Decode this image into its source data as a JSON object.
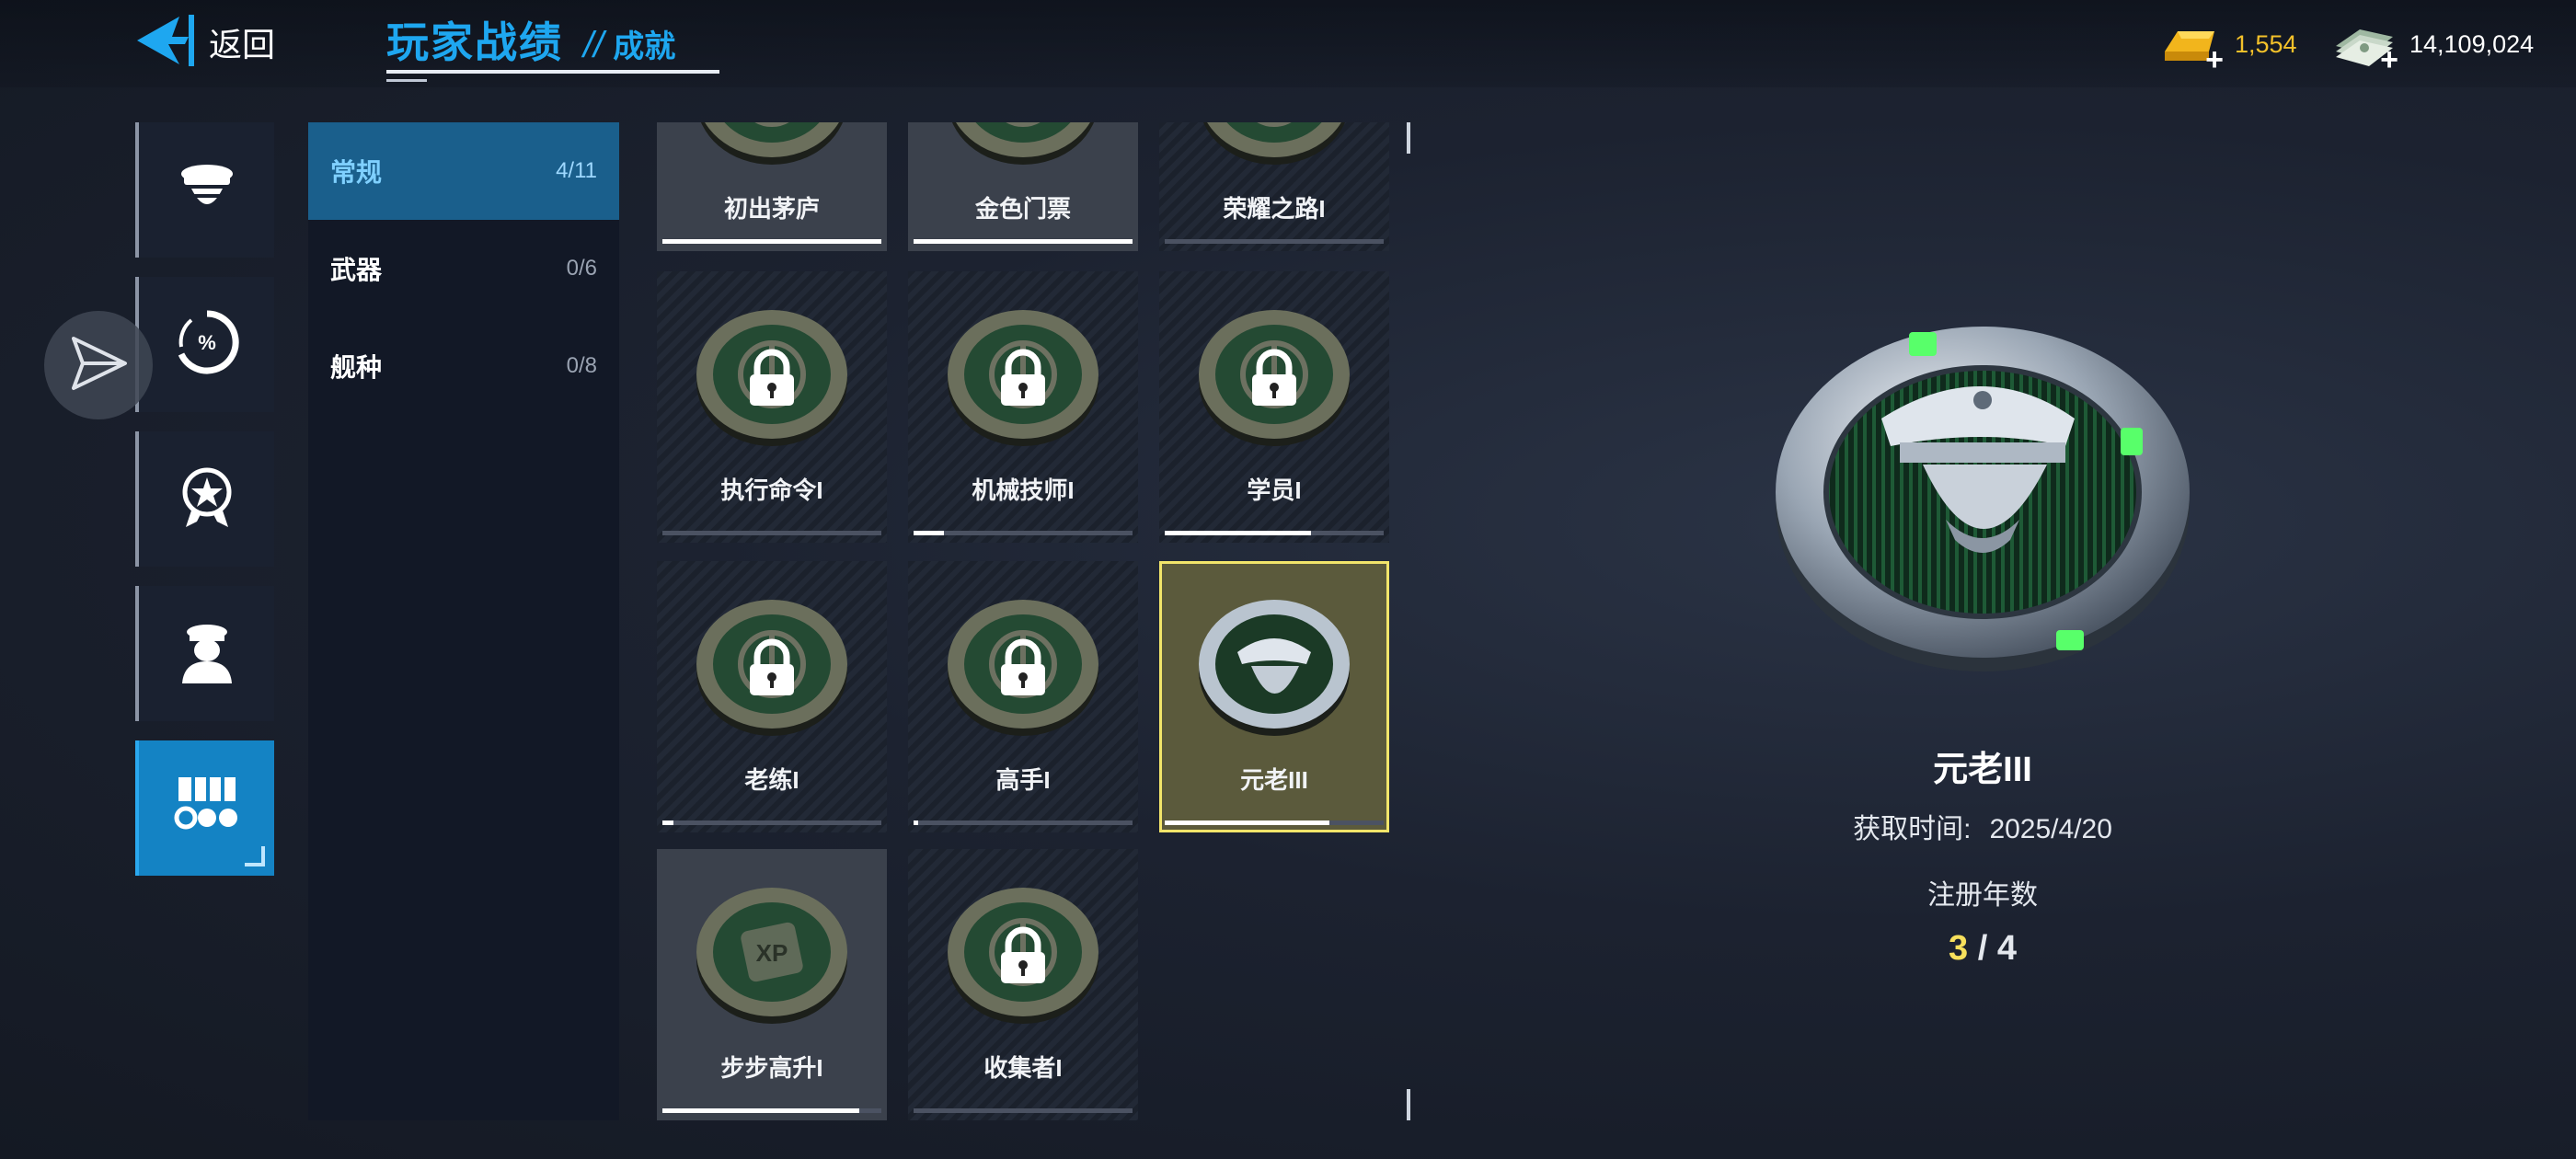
{
  "header": {
    "back_label": "返回",
    "title": "玩家战绩",
    "separator": "//",
    "subtitle": "成就"
  },
  "currency": {
    "gold": {
      "icon": "gold-bar-icon",
      "value": "1,554",
      "color": "#f4c12a"
    },
    "cash": {
      "icon": "cash-stack-icon",
      "value": "14,109,024",
      "color": "#ffffff"
    }
  },
  "nav": {
    "items": [
      {
        "icon": "officer-cap-icon",
        "active": false
      },
      {
        "icon": "percentage-gauge-icon",
        "active": false
      },
      {
        "icon": "star-badge-icon",
        "active": false
      },
      {
        "icon": "captain-bust-icon",
        "active": false
      },
      {
        "icon": "medals-ribbon-icon",
        "active": true
      }
    ],
    "floating_button_icon": "paper-plane-icon"
  },
  "categories": [
    {
      "label": "常规",
      "count": "4/11",
      "active": true
    },
    {
      "label": "武器",
      "count": "0/6",
      "active": false
    },
    {
      "label": "舰种",
      "count": "0/8",
      "active": false
    }
  ],
  "achievements": [
    {
      "label": "初出茅庐",
      "locked": false,
      "progress": 1.0,
      "icon": "anchor-medal-icon"
    },
    {
      "label": "金色门票",
      "locked": false,
      "progress": 1.0,
      "icon": "ticket-medal-icon"
    },
    {
      "label": "荣耀之路I",
      "locked": false,
      "progress": 0.0,
      "icon": "laurel-medal-icon"
    },
    {
      "label": "执行命令I",
      "locked": true,
      "progress": 0.0,
      "icon": "helm-wheel-medal-icon"
    },
    {
      "label": "机械技师I",
      "locked": true,
      "progress": 0.14,
      "icon": "wrench-medal-icon"
    },
    {
      "label": "学员I",
      "locked": true,
      "progress": 0.67,
      "icon": "anchor-medal-icon"
    },
    {
      "label": "老练I",
      "locked": true,
      "progress": 0.05,
      "icon": "anchor-medal-icon"
    },
    {
      "label": "高手I",
      "locked": true,
      "progress": 0.02,
      "icon": "anchor-medal-icon"
    },
    {
      "label": "元老III",
      "locked": false,
      "progress": 0.75,
      "icon": "veteran-captain-medal-icon"
    },
    {
      "label": "步步高升I",
      "locked": false,
      "progress": 0.9,
      "icon": "xp-medal-icon"
    },
    {
      "label": "收集者I",
      "locked": true,
      "progress": 0.0,
      "icon": "box-medal-icon"
    }
  ],
  "detail": {
    "title": "元老III",
    "acquired_label": "获取时间:",
    "acquired_date": "2025/4/20",
    "condition_label": "注册年数",
    "progress_current": "3",
    "progress_separator": " / ",
    "progress_total": "4",
    "medal_icon": "veteran-captain-medal-icon",
    "accent_color": "#f7e05c"
  }
}
